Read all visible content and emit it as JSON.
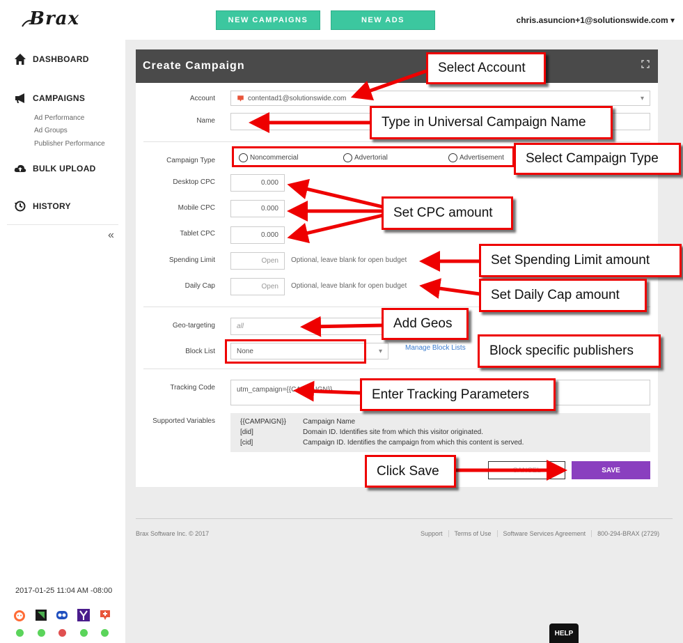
{
  "header": {
    "logo_text": "Brax",
    "new_campaigns": "NEW CAMPAIGNS",
    "new_ads": "NEW ADS",
    "user_email": "chris.asuncion+1@solutionswide.com ▾"
  },
  "sidebar": {
    "items": [
      {
        "label": "DASHBOARD",
        "icon": "home-icon"
      },
      {
        "label": "CAMPAIGNS",
        "icon": "megaphone-icon"
      },
      {
        "label": "BULK UPLOAD",
        "icon": "cloud-upload-icon"
      },
      {
        "label": "HISTORY",
        "icon": "history-icon"
      }
    ],
    "sub_items": [
      "Ad Performance",
      "Ad Groups",
      "Publisher Performance"
    ],
    "collapse": "«",
    "timestamp": "2017-01-25 11:04 AM -08:00",
    "status_colors": [
      "#5bd45b",
      "#5bd45b",
      "#e05050",
      "#5bd45b",
      "#5bd45b"
    ]
  },
  "form": {
    "title": "Create Campaign",
    "account_label": "Account",
    "account_value": "contentad1@solutionswide.com",
    "name_label": "Name",
    "campaign_type_label": "Campaign Type",
    "campaign_types": [
      "Noncommercial",
      "Advertorial",
      "Advertisement"
    ],
    "desktop_cpc_label": "Desktop CPC",
    "desktop_cpc": "0.000",
    "mobile_cpc_label": "Mobile CPC",
    "mobile_cpc": "0.000",
    "tablet_cpc_label": "Tablet CPC",
    "tablet_cpc": "0.000",
    "spending_limit_label": "Spending Limit",
    "spending_limit_placeholder": "Open",
    "spending_hint": "Optional, leave blank for open budget",
    "daily_cap_label": "Daily Cap",
    "daily_cap_placeholder": "Open",
    "daily_hint": "Optional, leave blank for open budget",
    "geo_label": "Geo-targeting",
    "geo_placeholder": "all",
    "block_list_label": "Block List",
    "block_list_value": "None",
    "manage_block_lists": "Manage Block Lists",
    "tracking_label": "Tracking Code",
    "tracking_value": "utm_campaign={{CAMPAIGN}}",
    "supported_label": "Supported Variables",
    "variables": [
      {
        "key": "{{CAMPAIGN}}",
        "desc": "Campaign Name"
      },
      {
        "key": "[did]",
        "desc": "Domain ID. Identifies site from which this visitor originated."
      },
      {
        "key": "[cid]",
        "desc": "Campaign ID. Identifies the campaign from which this content is served."
      }
    ],
    "cancel": "CANCEL",
    "save": "SAVE"
  },
  "footer": {
    "copyright": "Brax Software Inc. © 2017",
    "links": [
      "Support",
      "Terms of Use",
      "Software Services Agreement",
      "800-294-BRAX (2729)"
    ],
    "help": "HELP"
  },
  "annotations": {
    "select_account": "Select Account",
    "campaign_name": "Type in Universal Campaign Name",
    "campaign_type": "Select Campaign Type",
    "cpc": "Set CPC amount",
    "spending": "Set Spending Limit amount",
    "daily": "Set Daily Cap amount",
    "geos": "Add Geos",
    "block": "Block specific publishers",
    "tracking": "Enter Tracking Parameters",
    "save": "Click Save"
  }
}
